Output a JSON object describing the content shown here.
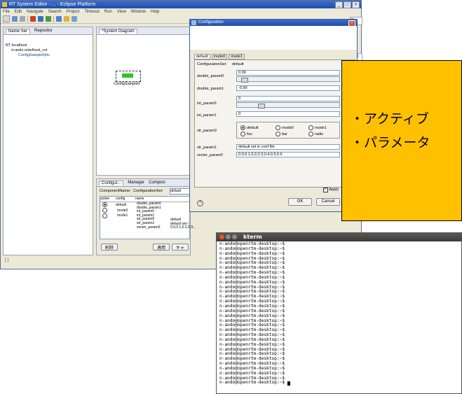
{
  "eclipse": {
    "title": "RT System Editor - ... - Eclipse Platform",
    "menu": [
      "File",
      "Edit",
      "Navigate",
      "Search",
      "Project",
      "Timeout",
      "Run",
      "View",
      "Window",
      "Help"
    ],
    "name_server_tab": "Name Ser",
    "repository_tab": "Repositor",
    "tree": [
      "RT localhost",
      "rt-ando.notelhost_cxt",
      "ConfigSample0|rtc"
    ],
    "diagram_tab": "*System Diagram",
    "component_label": "ConfigSample0",
    "status_placeholder": "[ ]",
    "right_tabs": [
      "ec",
      "notelc"
    ]
  },
  "config_view": {
    "tabs": [
      "Configur...",
      "Manager",
      "Composi"
    ],
    "component_name_label": "ComponentName:",
    "configset_label": "ConfigurationSet:",
    "configset_value": "default",
    "headers": [
      "active",
      "config",
      "name"
    ],
    "rows": [
      {
        "config": "default",
        "active": true
      },
      {
        "config": "mode0",
        "active": false
      },
      {
        "config": "mode1",
        "active": false
      }
    ],
    "param_names": [
      "double_param0",
      "double_param1",
      "int_param0",
      "int_param1",
      "str_param0",
      "str_param1",
      "vector_param0"
    ],
    "values": [
      "default",
      "default set i",
      "0.0,0.1,0.2,0.3..."
    ],
    "buttons": [
      "削除",
      "適用",
      "キャ"
    ]
  },
  "dialog": {
    "title": "Configuration",
    "tabs": [
      "default",
      "mode0",
      "mode1"
    ],
    "configset_label": "ConfigurationSet:",
    "configset_value": "default",
    "params": [
      {
        "name": "double_param0",
        "value": "0.99"
      },
      {
        "name": "double_param1",
        "value": "-0.99"
      },
      {
        "name": "int_param0",
        "value": "0"
      },
      {
        "name": "int_param1",
        "value": "0"
      },
      {
        "name": "str_param0",
        "value": ""
      },
      {
        "name": "str_param1",
        "value": "default set in conf file"
      },
      {
        "name": "vector_param0",
        "value": "0.0,0.1,0.2,0.3,0.4,0.5,0.6"
      }
    ],
    "str_options": [
      "default",
      "mode0",
      "mode1",
      "foo",
      "bar",
      "radio"
    ],
    "apply_check": "Apply",
    "ok": "OK",
    "cancel": "Cancel",
    "help": "?"
  },
  "callout": {
    "line1": "・アクティブ",
    "line2": "・パラメータ"
  },
  "kterm": {
    "title": "kterm",
    "prompt": "n-ando@openrtm-desktop:~$",
    "line_count": 30
  }
}
